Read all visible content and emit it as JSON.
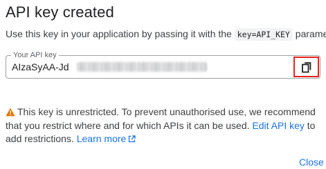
{
  "dialog": {
    "title": "API key created",
    "description_before": "Use this key in your application by passing it with the ",
    "description_code": "key=API_KEY",
    "description_after": " parameter."
  },
  "api_key_field": {
    "label": "Your API key",
    "visible_value": "AIzaSyAA-Jd",
    "copy_icon": "copy-icon",
    "highlight_color": "#e8211c"
  },
  "warning": {
    "icon": "warning-icon",
    "icon_color": "#e37400",
    "text_before": "This key is unrestricted. To prevent unauthorised use, we recommend that you restrict where and for which APIs it can be used. ",
    "edit_link": "Edit API key",
    "text_middle": " to add restrictions. ",
    "learn_more_link": "Learn more",
    "external_icon": "external-link-icon"
  },
  "actions": {
    "close_label": "Close"
  },
  "colors": {
    "link": "#1a73e8",
    "text": "#202124",
    "secondary_text": "#3c4043"
  }
}
